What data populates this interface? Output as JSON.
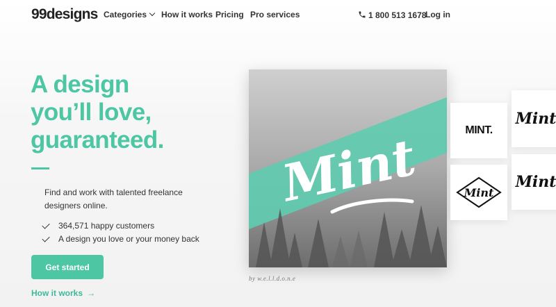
{
  "nav": {
    "logo": "99designs",
    "categories": "Categories",
    "how_it_works": "How it works",
    "pricing": "Pricing",
    "pro_services": "Pro services",
    "phone": "1 800 513 1678",
    "login": "Log in"
  },
  "hero": {
    "headline_line1": "A design",
    "headline_line2": "you’ll love,",
    "headline_line3": "guaranteed.",
    "subtext": "Find and work with talented freelance designers online.",
    "bullets": [
      "364,571 happy customers",
      "A design you love or your money back"
    ],
    "cta": "Get started",
    "secondary_link": "How it works",
    "image_text": "Mint",
    "image_credit": "by w.e.l.l.d.o.n.e"
  },
  "thumbnails": {
    "t1": "MINT.",
    "t2": "Mint",
    "t3": "Mint",
    "t4": "Mint"
  },
  "colors": {
    "accent": "#4cc6a3",
    "text": "#2b2b2b"
  }
}
